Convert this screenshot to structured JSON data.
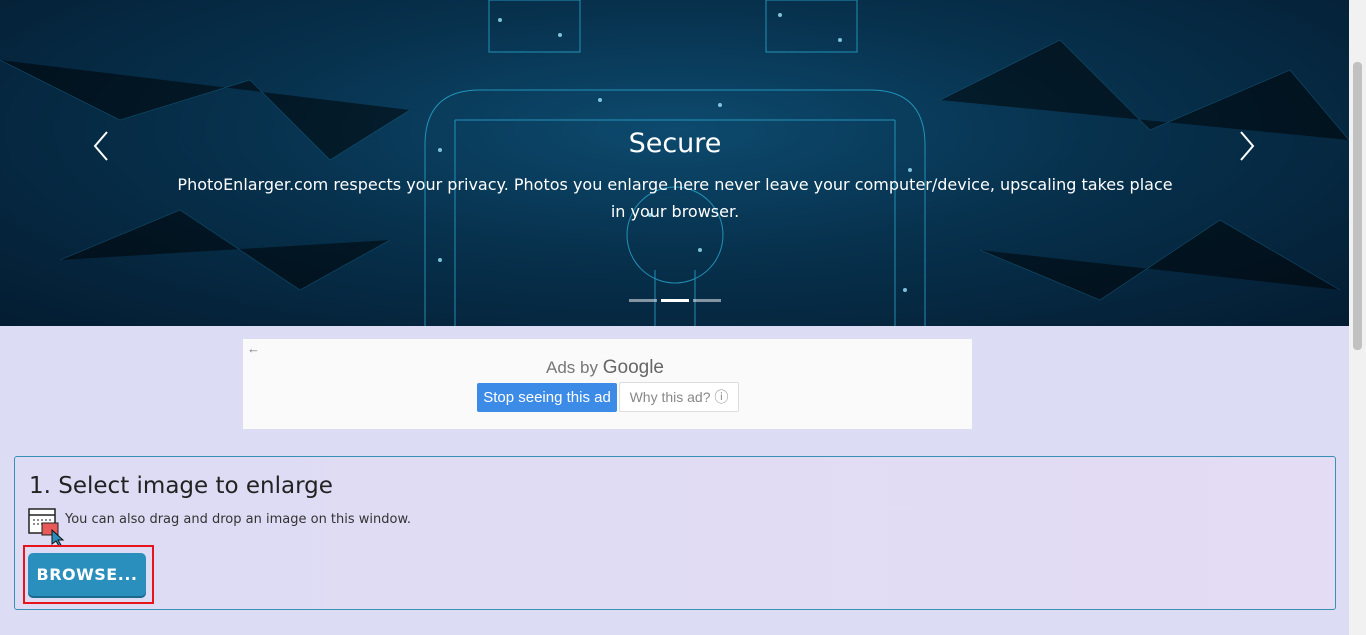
{
  "carousel": {
    "title": "Secure",
    "text": "PhotoEnlarger.com respects your privacy. Photos you enlarge here never leave your computer/device, upscaling takes place in your browser.",
    "prev_icon": "chevron-left-icon",
    "next_icon": "chevron-right-icon",
    "slides": 3,
    "active_slide": 2
  },
  "ad": {
    "back_icon": "←",
    "ads_by": "Ads by",
    "brand": "Google",
    "stop_label": "Stop seeing this ad",
    "why_label": "Why this ad? ⓘ"
  },
  "upload": {
    "title": "1. Select image to enlarge",
    "drag_text": "You can also drag and drop an image on this window.",
    "browse_label": "BROWSE..."
  },
  "colors": {
    "accent": "#2a8fbd",
    "highlight": "#e8141c",
    "ad_button": "#3c8be6"
  }
}
